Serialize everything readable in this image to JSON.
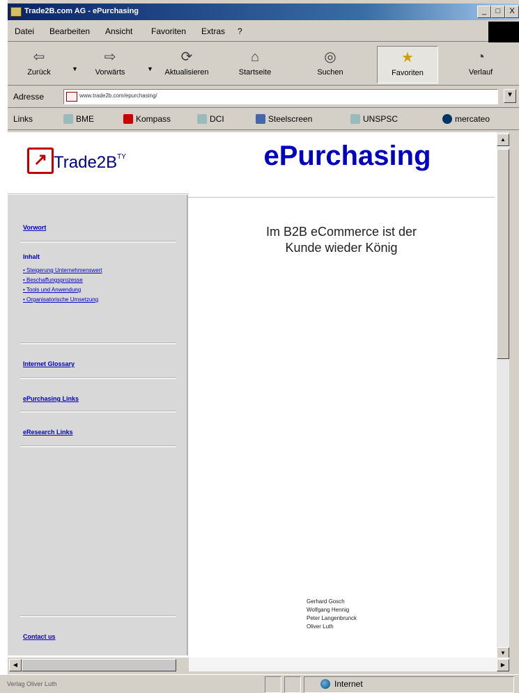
{
  "window": {
    "title": "Trade2B.com AG - ePurchasing",
    "buttons": [
      "_",
      "□",
      "X"
    ]
  },
  "menu": [
    "Datei",
    "Bearbeiten",
    "Ansicht",
    "Favoriten",
    "Extras",
    "?"
  ],
  "toolbar": [
    {
      "label": "Zurück",
      "icon": "back-arrow-icon"
    },
    {
      "label": "Vorwärts",
      "icon": "forward-arrow-icon"
    },
    {
      "label": "Aktualisieren",
      "icon": "refresh-icon"
    },
    {
      "label": "Startseite",
      "icon": "home-icon"
    },
    {
      "label": "Suchen",
      "icon": "search-icon"
    },
    {
      "label": "Favoriten",
      "icon": "favorites-folder-icon"
    },
    {
      "label": "Verlauf",
      "icon": "history-icon"
    }
  ],
  "address": {
    "label": "Adresse",
    "value": "www.trade2b.com/epurchasing/"
  },
  "links": {
    "label": "Links",
    "items": [
      "BME",
      "Kompass",
      "DCI",
      "Steelscreen",
      "UNSPSC",
      "mercateo"
    ]
  },
  "page": {
    "logo_text": "Trade2B",
    "logo_tm": "TY",
    "title": "ePurchasing",
    "slogan_line1": "Im B2B eCommerce ist der",
    "slogan_line2": "Kunde wieder König",
    "authors": [
      "Gerhard Gosch",
      "Wolfgang Hennig",
      "Peter Langenbrunck",
      "Oliver Luth"
    ]
  },
  "nav": {
    "vorwort": "Vorwort",
    "inhalt": "Inhalt",
    "inhalt_items": [
      "• Steigerung Unternehmenswert",
      "• Beschaffungsprozesse",
      "• Tools und Anwendung",
      "• Organisatorische Umsetzung"
    ],
    "glossary": "Internet Glossary",
    "epurchasing_links": "ePurchasing Links",
    "eresearch_links": "eResearch Links",
    "contact": "Contact us"
  },
  "status": {
    "text": "Verlag Oliver Luth",
    "zone": "Internet"
  },
  "colors": {
    "title_blue": "#0000c0",
    "nav_bg": "#d8d8d8",
    "chrome": "#d4d0c8"
  }
}
